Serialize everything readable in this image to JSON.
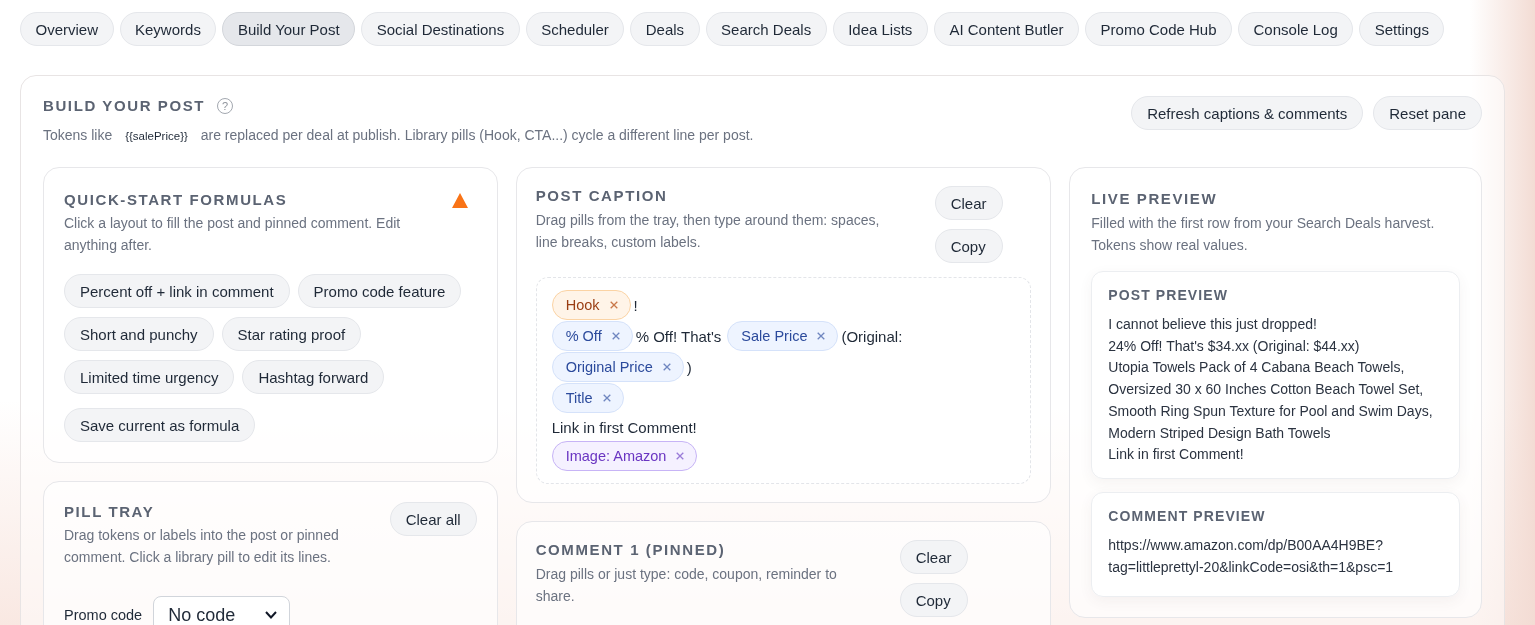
{
  "tabs": [
    {
      "label": "Overview",
      "selected": false
    },
    {
      "label": "Keywords",
      "selected": false
    },
    {
      "label": "Build Your Post",
      "selected": true
    },
    {
      "label": "Social Destinations",
      "selected": false
    },
    {
      "label": "Scheduler",
      "selected": false
    },
    {
      "label": "Deals",
      "selected": false
    },
    {
      "label": "Search Deals",
      "selected": false
    },
    {
      "label": "Idea Lists",
      "selected": false
    },
    {
      "label": "AI Content Butler",
      "selected": false
    },
    {
      "label": "Promo Code Hub",
      "selected": false
    },
    {
      "label": "Console Log",
      "selected": false
    },
    {
      "label": "Settings",
      "selected": false
    }
  ],
  "panel": {
    "title": "BUILD YOUR POST",
    "help": "?",
    "description": {
      "before": "Tokens like",
      "code": "{{salePrice}}",
      "after": "are replaced per deal at publish. Library pills (Hook, CTA...) cycle a different line per post."
    },
    "refresh_button": "Refresh captions & comments",
    "reset_button": "Reset pane"
  },
  "quick_start": {
    "title": "QUICK-START FORMULAS",
    "description": "Click a layout to fill the post and pinned comment. Edit anything after.",
    "formulas": [
      "Percent off + link in comment",
      "Promo code feature",
      "Short and punchy",
      "Star rating proof",
      "Limited time urgency",
      "Hashtag forward"
    ],
    "save_button": "Save current as formula"
  },
  "pill_tray": {
    "title": "PILL TRAY",
    "description": "Drag tokens or labels into the post or pinned comment. Click a library pill to edit its lines.",
    "clear_button": "Clear all",
    "promo_code": {
      "label": "Promo code",
      "value": "No code"
    }
  },
  "post_caption": {
    "title": "POST CAPTION",
    "description": "Drag pills from the tray, then type around them: spaces, line breaks, custom labels.",
    "clear_button": "Clear",
    "copy_button": "Copy",
    "lines": [
      [
        {
          "kind": "library",
          "label": "Hook"
        },
        {
          "kind": "text",
          "text": "!"
        }
      ],
      [
        {
          "kind": "token",
          "label": "% Off"
        },
        {
          "kind": "text",
          "text": "% Off! That's"
        },
        {
          "kind": "token",
          "label": "Sale Price"
        },
        {
          "kind": "text",
          "text": "(Original:"
        }
      ],
      [
        {
          "kind": "token",
          "label": "Original Price"
        },
        {
          "kind": "text",
          "text": ")"
        }
      ],
      [
        {
          "kind": "token",
          "label": "Title"
        }
      ],
      [
        {
          "kind": "text",
          "text": "Link in first Comment!"
        }
      ],
      [
        {
          "kind": "image",
          "label": "Image: Amazon"
        }
      ]
    ]
  },
  "comment": {
    "title": "COMMENT 1 (PINNED)",
    "description": "Drag pills or just type: code, coupon, reminder to share.",
    "clear_button": "Clear",
    "copy_button": "Copy"
  },
  "live_preview": {
    "title": "LIVE PREVIEW",
    "description": "Filled with the first row from your Search Deals harvest. Tokens show real values.",
    "post_preview": {
      "title": "POST PREVIEW",
      "paragraphs": [
        "I cannot believe this just dropped!",
        "24% Off! That's $34.xx (Original: $44.xx)",
        "Utopia Towels Pack of 4 Cabana Beach Towels, Oversized 30 x 60 Inches Cotton Beach Towel Set, Smooth Ring Spun Texture for Pool and Swim Days, Modern Striped Design Bath Towels",
        "Link in first Comment!"
      ]
    },
    "comment_preview": {
      "title": "COMMENT PREVIEW",
      "text": "https://www.amazon.com/dp/B00AA4H9BE?tag=littleprettyl-20&linkCode=osi&th=1&psc=1"
    }
  }
}
